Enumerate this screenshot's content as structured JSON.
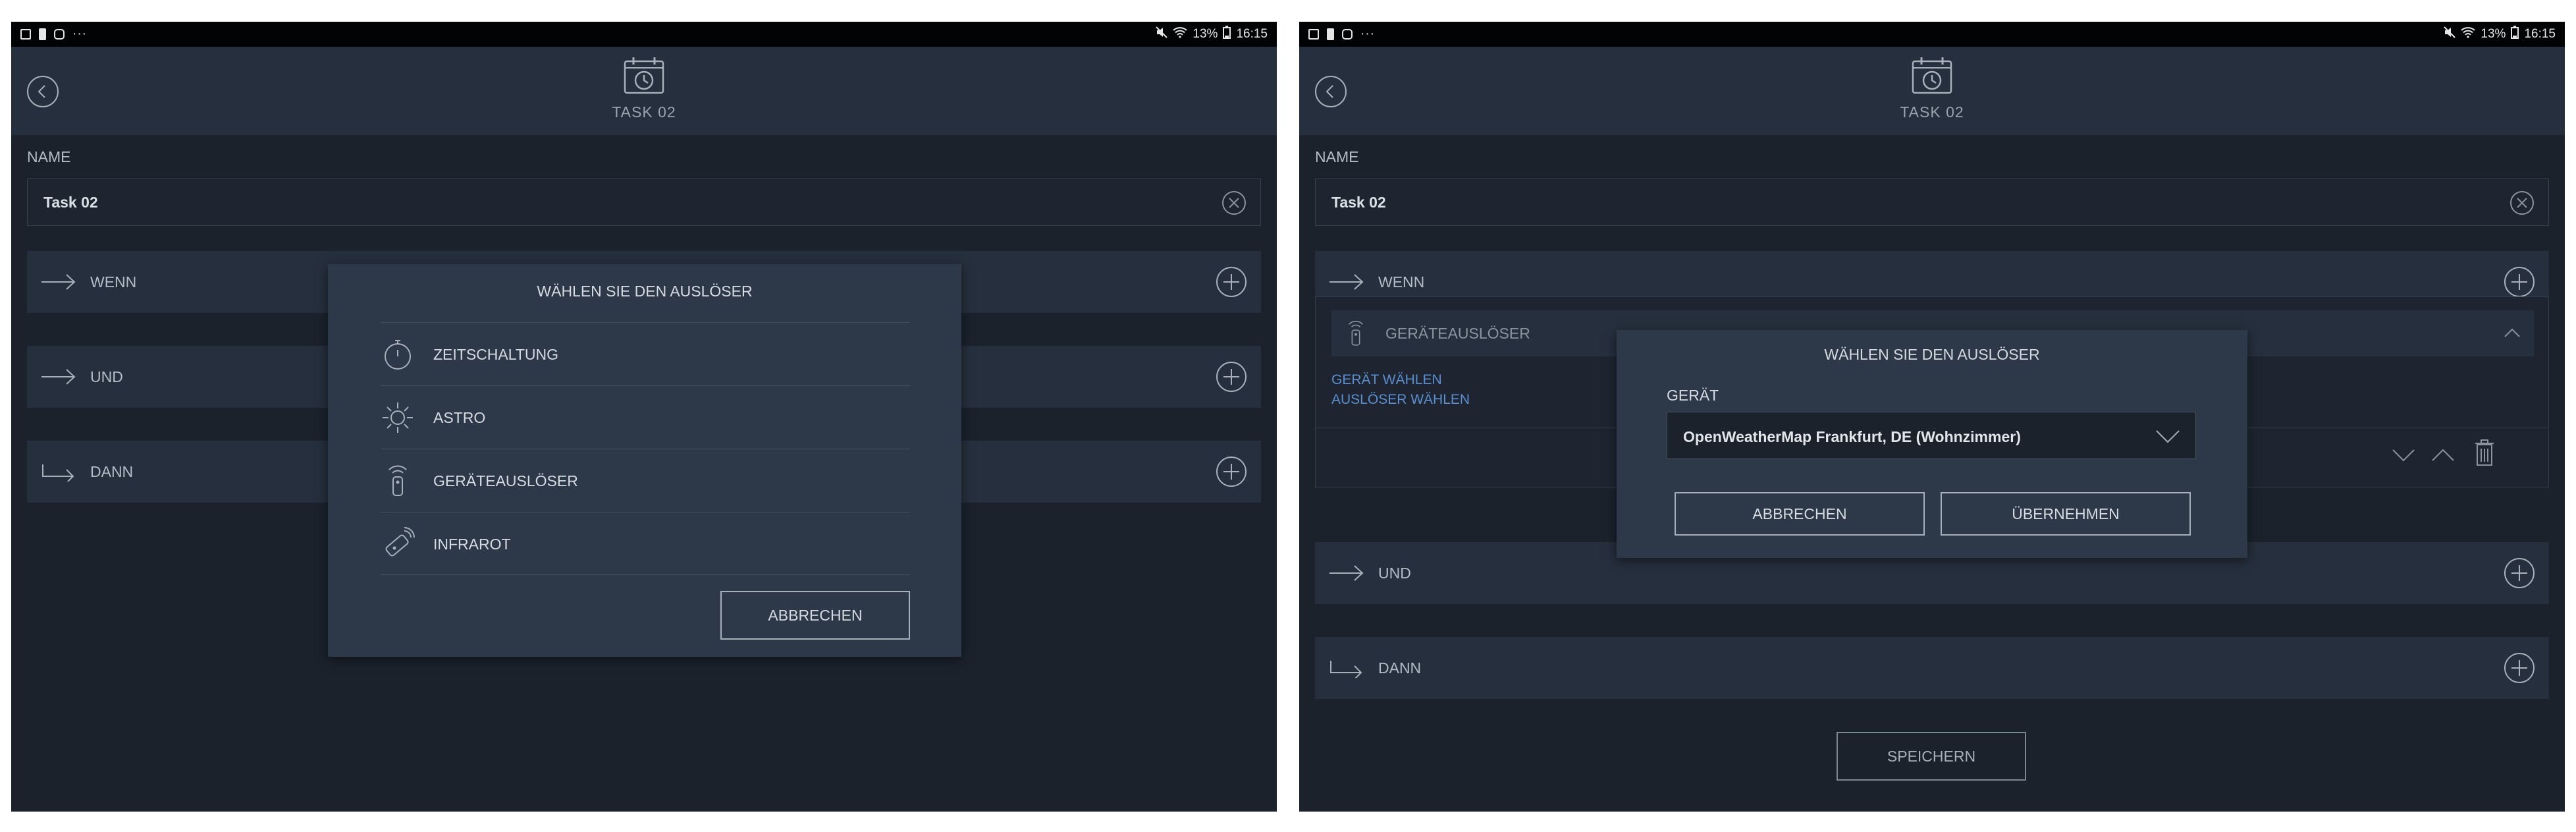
{
  "status_bar": {
    "mute": "🔇",
    "wifi": "wifi",
    "battery": "13%",
    "time": "16:15",
    "more": "···"
  },
  "left": {
    "header": {
      "title": "TASK 02"
    },
    "name_label": "NAME",
    "name_value": "Task 02",
    "sections": {
      "wenn": "WENN",
      "und": "UND",
      "dann": "DANN"
    },
    "dialog": {
      "title": "WÄHLEN SIE DEN AUSLÖSER",
      "options": [
        {
          "label": "ZEITSCHALTUNG",
          "icon": "stopwatch-icon"
        },
        {
          "label": "ASTRO",
          "icon": "sun-icon"
        },
        {
          "label": "GERÄTEAUSLÖSER",
          "icon": "remote-signal-icon"
        },
        {
          "label": "INFRAROT",
          "icon": "infrared-remote-icon"
        }
      ],
      "cancel": "ABBRECHEN"
    }
  },
  "right": {
    "header": {
      "title": "TASK 02"
    },
    "name_label": "NAME",
    "name_value": "Task 02",
    "sections": {
      "wenn": "WENN",
      "und": "UND",
      "dann": "DANN"
    },
    "trigger": {
      "title": "GERÄTEAUSLÖSER",
      "link_device": "GERÄT WÄHLEN",
      "link_trigger": "AUSLÖSER WÄHLEN"
    },
    "dialog": {
      "title": "WÄHLEN SIE DEN AUSLÖSER",
      "device_label": "GERÄT",
      "device_value": "OpenWeatherMap Frankfurt, DE (Wohnzimmer)",
      "cancel": "ABBRECHEN",
      "apply": "ÜBERNEHMEN"
    },
    "save": "SPEICHERN"
  },
  "colors": {
    "background": "#1b222c",
    "panel": "#262f3d",
    "dialog": "#2d3949",
    "link": "#5b8fd0",
    "text": "#d6dbe2"
  }
}
